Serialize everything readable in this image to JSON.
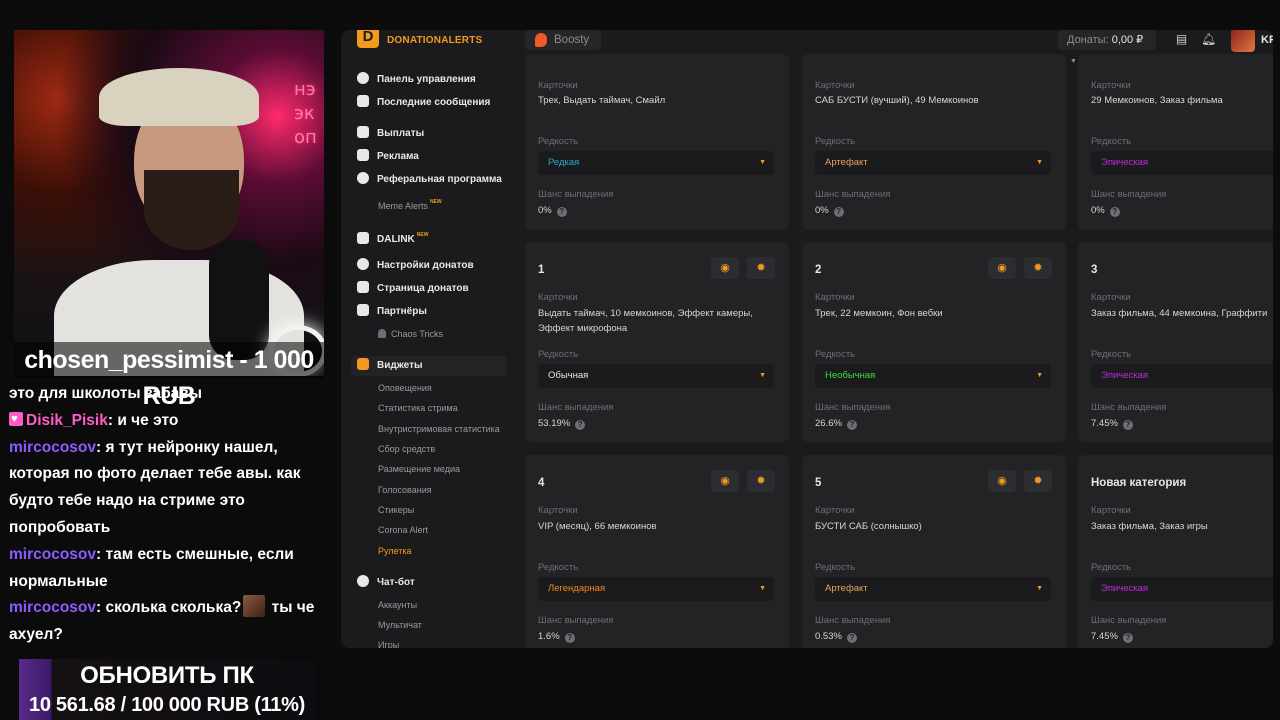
{
  "stream": {
    "neon_sign": "нэ эк оп",
    "donor_banner": "chosen_pessimist - 1 000 RUB",
    "chat": [
      {
        "nick": "",
        "text": "это для школоты забавы"
      },
      {
        "nick": "Disik_Pisik",
        "text": " и че это"
      },
      {
        "nick": "mircocosov",
        "text": " я тут нейронку нашел, которая по фото делает тебе авы. как будто тебе надо на стриме это попробовать"
      },
      {
        "nick": "mircocosov",
        "text": " там есть смешные, если нормальные"
      },
      {
        "nick": "mircocosov",
        "text": " сколька сколька?",
        "text_after_emote": " ты че ахуел?"
      }
    ],
    "goal_title": "ОБНОВИТЬ ПК",
    "goal_progress": "10 561.68 / 100 000 RUB (11%)",
    "goal_fraction": 0.11
  },
  "topbar": {
    "brand_glyph": "D",
    "brand": "DONATIONALERTS",
    "boosty": "Boosty",
    "donations_label": "Донаты:",
    "donations_value": "0,00 ₽",
    "user_abbr": "KP"
  },
  "sidebar": {
    "main": [
      "Панель управления",
      "Последние сообщения"
    ],
    "finance": [
      "Выплаты",
      "Реклама",
      "Реферальная программа"
    ],
    "meme_alerts": "Meme Alerts",
    "new_badge": "NEW",
    "dalink": "DALINK",
    "settings": [
      "Настройки донатов",
      "Страница донатов",
      "Партнёры"
    ],
    "chaos_tricks": "Chaos Tricks",
    "widgets": "Виджеты",
    "widget_items": [
      "Оповещения",
      "Статистика стрима",
      "Внутристримовая статистика",
      "Сбор средств",
      "Размещение медиа",
      "Голосования",
      "Стикеры",
      "Corona Alert",
      "Рулетка"
    ],
    "chatbot": "Чат-бот",
    "chatbot_items": [
      "Аккаунты",
      "Мультичат",
      "Игры"
    ]
  },
  "labels": {
    "cards": "Карточки",
    "rarity": "Редкость",
    "chance": "Шанс выпадения"
  },
  "top_cards": [
    {
      "cards": "Трек, Выдать таймач, Смайл",
      "rarity": "Редкая",
      "rarity_color": "#2aa7c9",
      "chance": "0%"
    },
    {
      "cards": "САБ БУСТИ (вучший), 49 Мемкоинов",
      "rarity": "Артефакт",
      "rarity_color": "#e8a25a",
      "chance": "0%"
    },
    {
      "cards": "29 Мемкоинов, Заказ фильма",
      "rarity": "Эпическая",
      "rarity_color": "#c02ad8",
      "chance": "0%"
    }
  ],
  "cards": [
    {
      "title": "1",
      "cards": "Выдать таймач, 10 мемкоинов, Эффект камеры, Эффект микрофона",
      "rarity": "Обычная",
      "rarity_color": "#e6e6e6",
      "chance": "53.19%"
    },
    {
      "title": "2",
      "cards": "Трек, 22 мемкоин, Фон вебки",
      "rarity": "Необычная",
      "rarity_color": "#3ddc3d",
      "chance": "26.6%"
    },
    {
      "title": "3",
      "cards": "Заказ фильма, 44 мемкоина, Граффити",
      "rarity": "Эпическая",
      "rarity_color": "#c02ad8",
      "chance": "7.45%"
    },
    {
      "title": "4",
      "cards": "VIP (месяц), 66 мемкоинов",
      "rarity": "Легендарная",
      "rarity_color": "#f28a1d",
      "chance": "1.6%"
    },
    {
      "title": "5",
      "cards": "БУСТИ САБ (солнышко)",
      "rarity": "Артефакт",
      "rarity_color": "#e8a25a",
      "chance": "0.53%"
    },
    {
      "title": "Новая категория",
      "cards": "Заказ фильма, Заказ игры",
      "rarity": "Эпическая",
      "rarity_color": "#c02ad8",
      "chance": "7.45%"
    }
  ],
  "icons": {
    "eye": "eye-icon",
    "gear": "gear-icon",
    "help": "question-icon",
    "chevron": "chevron-down-icon"
  }
}
